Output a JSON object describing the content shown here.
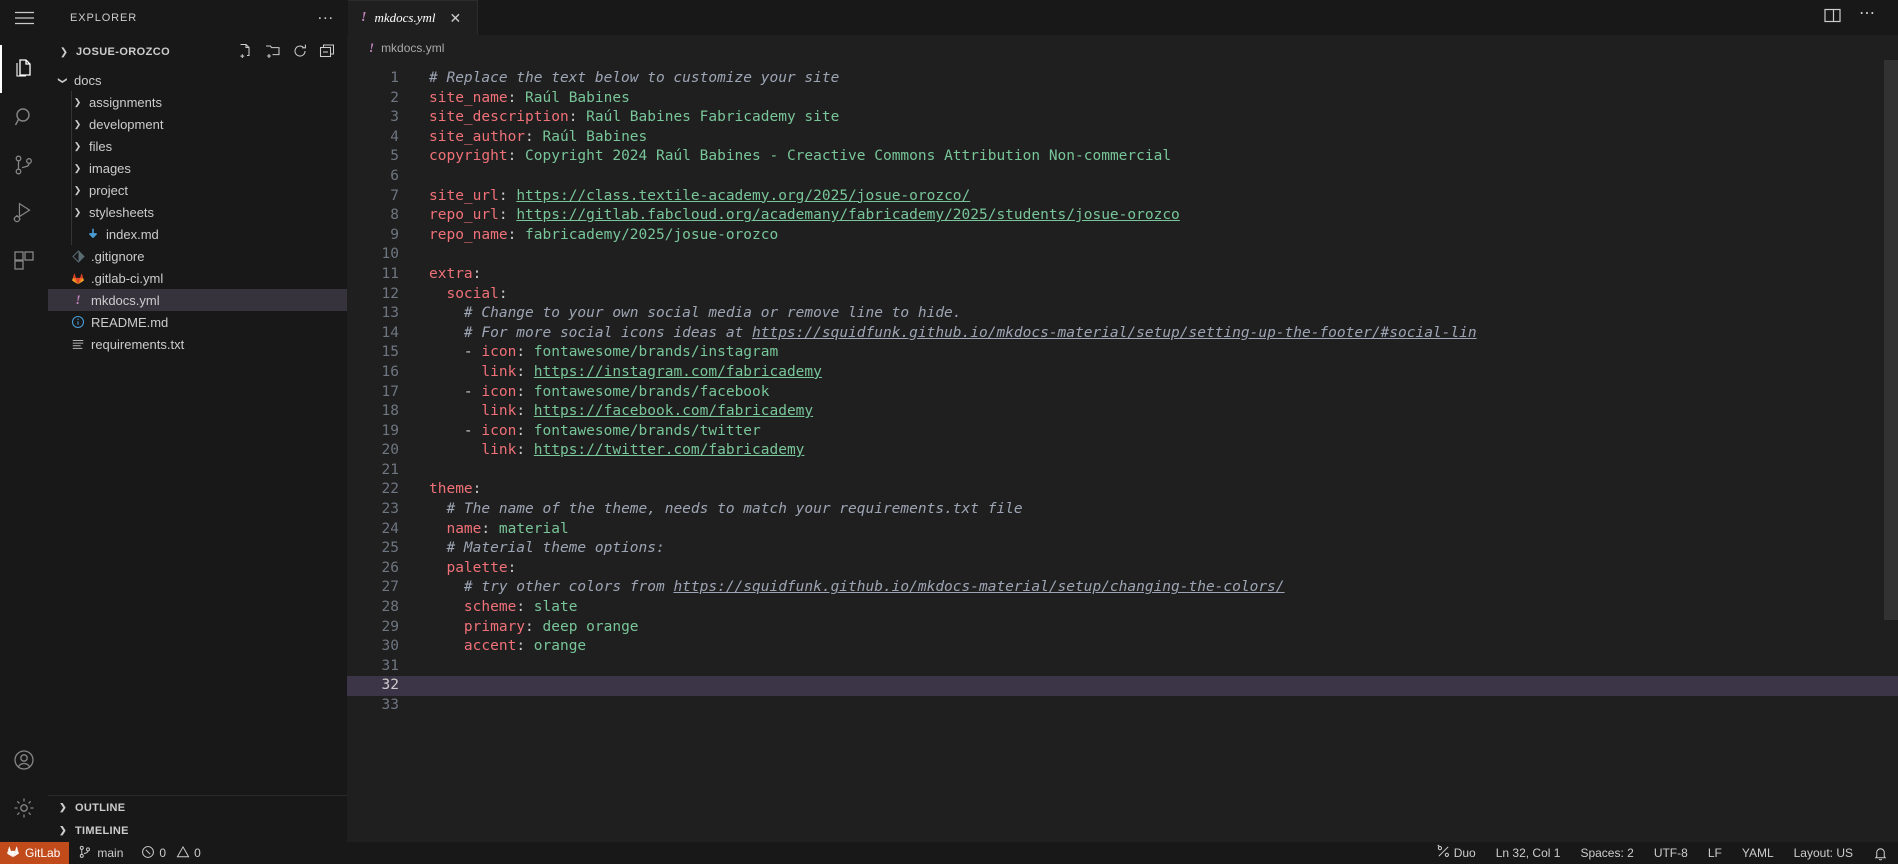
{
  "window": {
    "explorer_title": "EXPLORER",
    "more_actions_label": "...",
    "hamburger_icon": "hamburger-menu-icon",
    "split_editor_icon": "split-editor-right-icon",
    "more_icon": "ellipsis-icon"
  },
  "activitybar": {
    "items": [
      {
        "name": "explorer",
        "icon": "files-icon",
        "active": true
      },
      {
        "name": "search",
        "icon": "search-icon",
        "active": false
      },
      {
        "name": "source-control",
        "icon": "source-control-branch-icon",
        "active": false
      },
      {
        "name": "run-and-debug",
        "icon": "run-debug-play-bug-icon",
        "active": false
      },
      {
        "name": "extensions",
        "icon": "extensions-blocks-icon",
        "active": false
      }
    ],
    "bottom_items": [
      {
        "name": "accounts",
        "icon": "account-person-icon"
      },
      {
        "name": "manage",
        "icon": "gear-settings-icon"
      }
    ]
  },
  "sidebar": {
    "root_label": "JOSUE-OROZCO",
    "actions": [
      {
        "name": "new-file",
        "icon": "new-file-icon"
      },
      {
        "name": "new-folder",
        "icon": "new-folder-icon"
      },
      {
        "name": "refresh-explorer",
        "icon": "refresh-icon"
      },
      {
        "name": "collapse-folders",
        "icon": "collapse-all-icon"
      }
    ],
    "tree": [
      {
        "label": "docs",
        "type": "folder",
        "expanded": true,
        "depth": 1,
        "icon": "chevron-down-icon",
        "selected": false
      },
      {
        "label": "assignments",
        "type": "folder",
        "expanded": false,
        "depth": 2,
        "icon": "chevron-right-icon",
        "selected": false
      },
      {
        "label": "development",
        "type": "folder",
        "expanded": false,
        "depth": 2,
        "icon": "chevron-right-icon",
        "selected": false
      },
      {
        "label": "files",
        "type": "folder",
        "expanded": false,
        "depth": 2,
        "icon": "chevron-right-icon",
        "selected": false
      },
      {
        "label": "images",
        "type": "folder",
        "expanded": false,
        "depth": 2,
        "icon": "chevron-right-icon",
        "selected": false
      },
      {
        "label": "project",
        "type": "folder",
        "expanded": false,
        "depth": 2,
        "icon": "chevron-right-icon",
        "selected": false
      },
      {
        "label": "stylesheets",
        "type": "folder",
        "expanded": false,
        "depth": 2,
        "icon": "chevron-right-icon",
        "selected": false
      },
      {
        "label": "index.md",
        "type": "file",
        "depth": 2,
        "icon": "markdown-file-icon",
        "selected": false
      },
      {
        "label": ".gitignore",
        "type": "file",
        "depth": 1,
        "icon": "git-file-icon",
        "selected": false
      },
      {
        "label": ".gitlab-ci.yml",
        "type": "file",
        "depth": 1,
        "icon": "gitlab-fox-icon",
        "selected": false
      },
      {
        "label": "mkdocs.yml",
        "type": "file",
        "depth": 1,
        "icon": "yaml-file-icon",
        "selected": true
      },
      {
        "label": "README.md",
        "type": "file",
        "depth": 1,
        "icon": "info-circle-icon",
        "selected": false
      },
      {
        "label": "requirements.txt",
        "type": "file",
        "depth": 1,
        "icon": "text-lines-icon",
        "selected": false
      }
    ],
    "panels": [
      {
        "label": "OUTLINE",
        "icon": "chevron-right-icon"
      },
      {
        "label": "TIMELINE",
        "icon": "chevron-right-icon"
      }
    ]
  },
  "editor": {
    "tab": {
      "label": "mkdocs.yml",
      "icon": "yaml-file-icon",
      "close_icon": "close-x-icon",
      "dirty": false
    },
    "breadcrumb": {
      "label": "mkdocs.yml",
      "icon": "yaml-file-icon"
    },
    "lines": [
      {
        "n": 1,
        "tokens": [
          {
            "t": "# Replace the text below to customize your site",
            "c": "c"
          }
        ]
      },
      {
        "n": 2,
        "tokens": [
          {
            "t": "site_name",
            "c": "k"
          },
          {
            "t": ": ",
            "c": "p"
          },
          {
            "t": "Raúl Babines",
            "c": "s"
          }
        ]
      },
      {
        "n": 3,
        "tokens": [
          {
            "t": "site_description",
            "c": "k"
          },
          {
            "t": ": ",
            "c": "p"
          },
          {
            "t": "Raúl Babines Fabricademy site",
            "c": "s"
          }
        ]
      },
      {
        "n": 4,
        "tokens": [
          {
            "t": "site_author",
            "c": "k"
          },
          {
            "t": ": ",
            "c": "p"
          },
          {
            "t": "Raúl Babines",
            "c": "s"
          }
        ]
      },
      {
        "n": 5,
        "tokens": [
          {
            "t": "copyright",
            "c": "k"
          },
          {
            "t": ": ",
            "c": "p"
          },
          {
            "t": "Copyright 2024 Raúl Babines - Creactive Commons Attribution Non-commercial",
            "c": "s"
          }
        ]
      },
      {
        "n": 6,
        "tokens": []
      },
      {
        "n": 7,
        "tokens": [
          {
            "t": "site_url",
            "c": "k"
          },
          {
            "t": ": ",
            "c": "p"
          },
          {
            "t": "https://class.textile-academy.org/2025/josue-orozco/",
            "c": "u"
          }
        ]
      },
      {
        "n": 8,
        "tokens": [
          {
            "t": "repo_url",
            "c": "k"
          },
          {
            "t": ": ",
            "c": "p"
          },
          {
            "t": "https://gitlab.fabcloud.org/academany/fabricademy/2025/students/josue-orozco",
            "c": "u"
          }
        ]
      },
      {
        "n": 9,
        "tokens": [
          {
            "t": "repo_name",
            "c": "k"
          },
          {
            "t": ": ",
            "c": "p"
          },
          {
            "t": "fabricademy/2025/josue-orozco",
            "c": "s"
          }
        ]
      },
      {
        "n": 10,
        "tokens": []
      },
      {
        "n": 11,
        "tokens": [
          {
            "t": "extra",
            "c": "k"
          },
          {
            "t": ":",
            "c": "p"
          }
        ]
      },
      {
        "n": 12,
        "tokens": [
          {
            "t": "  ",
            "c": "p"
          },
          {
            "t": "social",
            "c": "k"
          },
          {
            "t": ":",
            "c": "p"
          }
        ]
      },
      {
        "n": 13,
        "tokens": [
          {
            "t": "    ",
            "c": "p"
          },
          {
            "t": "# Change to your own social media or remove line to hide.",
            "c": "c"
          }
        ]
      },
      {
        "n": 14,
        "tokens": [
          {
            "t": "    ",
            "c": "p"
          },
          {
            "t": "# For more social icons ideas at ",
            "c": "c"
          },
          {
            "t": "https://squidfunk.github.io/mkdocs-material/setup/setting-up-the-footer/#social-lin",
            "c": "uc"
          }
        ]
      },
      {
        "n": 15,
        "tokens": [
          {
            "t": "    - ",
            "c": "p"
          },
          {
            "t": "icon",
            "c": "k"
          },
          {
            "t": ": ",
            "c": "p"
          },
          {
            "t": "fontawesome/brands/instagram",
            "c": "s"
          }
        ]
      },
      {
        "n": 16,
        "tokens": [
          {
            "t": "      ",
            "c": "p"
          },
          {
            "t": "link",
            "c": "k"
          },
          {
            "t": ": ",
            "c": "p"
          },
          {
            "t": "https://instagram.com/fabricademy",
            "c": "u"
          }
        ]
      },
      {
        "n": 17,
        "tokens": [
          {
            "t": "    - ",
            "c": "p"
          },
          {
            "t": "icon",
            "c": "k"
          },
          {
            "t": ": ",
            "c": "p"
          },
          {
            "t": "fontawesome/brands/facebook",
            "c": "s"
          }
        ]
      },
      {
        "n": 18,
        "tokens": [
          {
            "t": "      ",
            "c": "p"
          },
          {
            "t": "link",
            "c": "k"
          },
          {
            "t": ": ",
            "c": "p"
          },
          {
            "t": "https://facebook.com/fabricademy",
            "c": "u"
          }
        ]
      },
      {
        "n": 19,
        "tokens": [
          {
            "t": "    - ",
            "c": "p"
          },
          {
            "t": "icon",
            "c": "k"
          },
          {
            "t": ": ",
            "c": "p"
          },
          {
            "t": "fontawesome/brands/twitter",
            "c": "s"
          }
        ]
      },
      {
        "n": 20,
        "tokens": [
          {
            "t": "      ",
            "c": "p"
          },
          {
            "t": "link",
            "c": "k"
          },
          {
            "t": ": ",
            "c": "p"
          },
          {
            "t": "https://twitter.com/fabricademy",
            "c": "u"
          }
        ]
      },
      {
        "n": 21,
        "tokens": []
      },
      {
        "n": 22,
        "tokens": [
          {
            "t": "theme",
            "c": "k"
          },
          {
            "t": ":",
            "c": "p"
          }
        ]
      },
      {
        "n": 23,
        "tokens": [
          {
            "t": "  ",
            "c": "p"
          },
          {
            "t": "# The name of the theme, needs to match your requirements.txt file",
            "c": "c"
          }
        ]
      },
      {
        "n": 24,
        "tokens": [
          {
            "t": "  ",
            "c": "p"
          },
          {
            "t": "name",
            "c": "k"
          },
          {
            "t": ": ",
            "c": "p"
          },
          {
            "t": "material",
            "c": "s"
          }
        ]
      },
      {
        "n": 25,
        "tokens": [
          {
            "t": "  ",
            "c": "p"
          },
          {
            "t": "# Material theme options:",
            "c": "c"
          }
        ]
      },
      {
        "n": 26,
        "tokens": [
          {
            "t": "  ",
            "c": "p"
          },
          {
            "t": "palette",
            "c": "k"
          },
          {
            "t": ":",
            "c": "p"
          }
        ]
      },
      {
        "n": 27,
        "tokens": [
          {
            "t": "    ",
            "c": "p"
          },
          {
            "t": "# try other colors from ",
            "c": "c"
          },
          {
            "t": "https://squidfunk.github.io/mkdocs-material/setup/changing-the-colors/",
            "c": "uc"
          }
        ]
      },
      {
        "n": 28,
        "tokens": [
          {
            "t": "    ",
            "c": "p"
          },
          {
            "t": "scheme",
            "c": "k"
          },
          {
            "t": ": ",
            "c": "p"
          },
          {
            "t": "slate",
            "c": "s"
          }
        ]
      },
      {
        "n": 29,
        "tokens": [
          {
            "t": "    ",
            "c": "p"
          },
          {
            "t": "primary",
            "c": "k"
          },
          {
            "t": ": ",
            "c": "p"
          },
          {
            "t": "deep orange",
            "c": "s"
          }
        ]
      },
      {
        "n": 30,
        "tokens": [
          {
            "t": "    ",
            "c": "p"
          },
          {
            "t": "accent",
            "c": "k"
          },
          {
            "t": ": ",
            "c": "p"
          },
          {
            "t": "orange",
            "c": "s"
          }
        ]
      },
      {
        "n": 31,
        "tokens": []
      },
      {
        "n": 32,
        "tokens": [],
        "current": true
      },
      {
        "n": 33,
        "tokens": []
      }
    ],
    "cursor_line": 32
  },
  "statusbar": {
    "left": [
      {
        "name": "gitlab",
        "label": "GitLab",
        "icon": "gitlab-fox-icon",
        "accent": "#c24b1c"
      },
      {
        "name": "branch",
        "label": "main",
        "icon": "source-control-branch-icon"
      },
      {
        "name": "problems",
        "label": "0  0",
        "errors": "0",
        "warnings": "0",
        "icon": "error-circle-icon",
        "icon2": "warning-triangle-icon"
      }
    ],
    "right": [
      {
        "name": "duo",
        "label": "Duo",
        "icon": "duo-sparkle-icon"
      },
      {
        "name": "cursor-position",
        "label": "Ln 32, Col 1"
      },
      {
        "name": "indentation",
        "label": "Spaces: 2"
      },
      {
        "name": "encoding",
        "label": "UTF-8"
      },
      {
        "name": "eol",
        "label": "LF"
      },
      {
        "name": "language-mode",
        "label": "YAML"
      },
      {
        "name": "keyboard-layout",
        "label": "Layout: US"
      },
      {
        "name": "notifications",
        "label": "",
        "icon": "bell-icon"
      }
    ]
  },
  "colors": {
    "bg": "#1f1f1f",
    "chrome": "#181818",
    "selection": "#37333d",
    "key": "#f07178",
    "string": "#78c699",
    "comment": "#9da5b4",
    "gitlab_orange": "#c24b1c",
    "yaml_icon": "#c586c0"
  }
}
